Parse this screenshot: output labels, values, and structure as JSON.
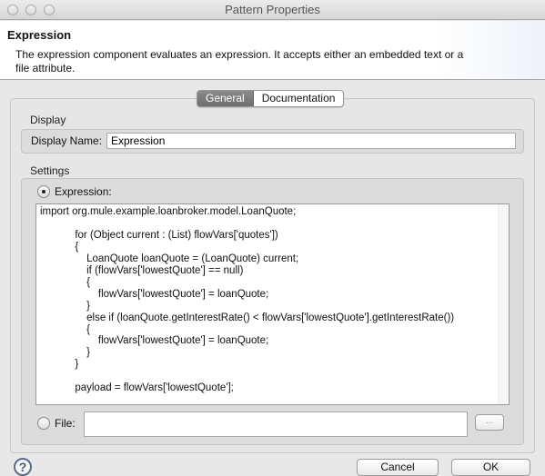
{
  "window": {
    "title": "Pattern Properties"
  },
  "header": {
    "title": "Expression",
    "description": "The expression component evaluates an expression. It accepts either an embedded text or a file attribute."
  },
  "tabs": [
    {
      "label": "General",
      "active": true
    },
    {
      "label": "Documentation",
      "active": false
    }
  ],
  "display": {
    "section_label": "Display",
    "name_label": "Display Name:",
    "name_value": "Expression"
  },
  "settings": {
    "section_label": "Settings",
    "expression_label": "Expression:",
    "expression_selected": true,
    "expression_code": "import org.mule.example.loanbroker.model.LoanQuote;\n\n            for (Object current : (List) flowVars['quotes'])\n            {\n                LoanQuote loanQuote = (LoanQuote) current;\n                if (flowVars['lowestQuote'] == null)\n                {\n                    flowVars['lowestQuote'] = loanQuote;\n                }\n                else if (loanQuote.getInterestRate() < flowVars['lowestQuote'].getInterestRate())\n                {\n                    flowVars['lowestQuote'] = loanQuote;\n                }\n            }\n\n            payload = flowVars['lowestQuote'];",
    "file_label": "File:",
    "file_selected": false,
    "file_value": "",
    "browse_label": "..."
  },
  "footer": {
    "help_icon": "?",
    "cancel_label": "Cancel",
    "ok_label": "OK"
  }
}
